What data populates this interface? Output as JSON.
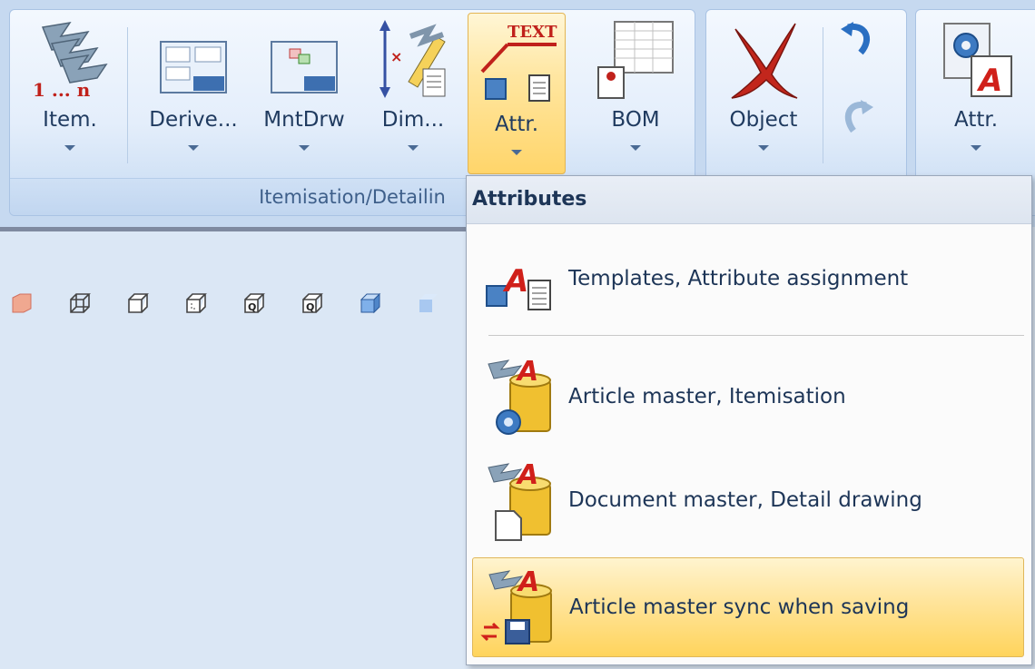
{
  "ribbon": {
    "group_title": "Itemisation/Detailin",
    "buttons": {
      "item": "Item.",
      "derive": "Derive...",
      "mntdrw": "MntDrw",
      "dim": "Dim...",
      "attr": "Attr.",
      "bom": "BOM",
      "object": "Object",
      "attr2": "Attr."
    },
    "item_icon_text": "1 ... n",
    "attr_icon_text": "TEXT"
  },
  "menu": {
    "title": "Attributes",
    "items": [
      {
        "label": "Templates, Attribute assignment"
      },
      {
        "label": "Article master, Itemisation"
      },
      {
        "label": "Document master, Detail drawing"
      },
      {
        "label": "Article master sync when saving"
      }
    ]
  },
  "colors": {
    "ribbon_bg": "#c6d9f0",
    "active_highlight": "#ffd56a",
    "menu_text": "#1d3557"
  }
}
